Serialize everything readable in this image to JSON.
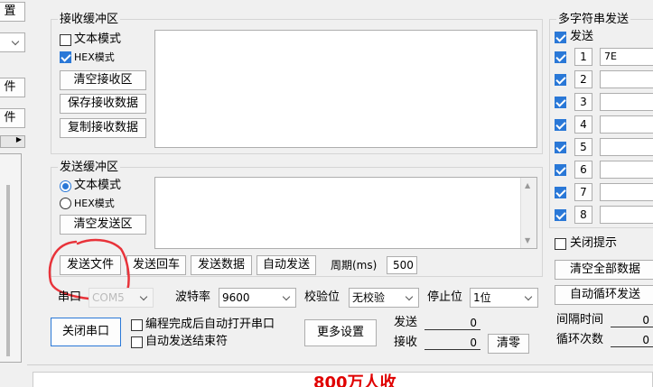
{
  "left_edge": {
    "top_label": "置",
    "item_a": "件",
    "item_b": "件"
  },
  "receive": {
    "title": "接收缓冲区",
    "text_mode": "文本模式",
    "hex_mode": "HEX模式",
    "clear_btn": "清空接收区",
    "save_btn": "保存接收数据",
    "copy_btn": "复制接收数据"
  },
  "send": {
    "title": "发送缓冲区",
    "text_mode": "文本模式",
    "hex_mode": "HEX模式",
    "clear_btn": "清空发送区"
  },
  "actions": {
    "send_file": "发送文件",
    "send_cr": "发送回车",
    "send_data": "发送数据",
    "auto_send": "自动发送",
    "period_label": "周期(ms)",
    "period_value": "500"
  },
  "port": {
    "port_label": "串口",
    "port_value": "COM5",
    "baud_label": "波特率",
    "baud_value": "9600",
    "parity_label": "校验位",
    "parity_value": "无校验",
    "stop_label": "停止位",
    "stop_value": "1位"
  },
  "bottom": {
    "close_port": "关闭串口",
    "auto_open": "编程完成后自动打开串口",
    "auto_end": "自动发送结束符",
    "more_settings": "更多设置",
    "send_label": "发送",
    "send_count": "0",
    "recv_label": "接收",
    "recv_count": "0",
    "clear_counts": "清零"
  },
  "multi": {
    "title": "多字符串发送",
    "send_label": "发送",
    "rows": [
      {
        "num": "1",
        "value": "7E"
      },
      {
        "num": "2",
        "value": ""
      },
      {
        "num": "3",
        "value": ""
      },
      {
        "num": "4",
        "value": ""
      },
      {
        "num": "5",
        "value": ""
      },
      {
        "num": "6",
        "value": ""
      },
      {
        "num": "7",
        "value": ""
      },
      {
        "num": "8",
        "value": ""
      }
    ],
    "close_tip": "关闭提示",
    "clear_all": "清空全部数据",
    "auto_loop": "自动循环发送",
    "interval_label": "间隔时间",
    "interval_value": "0",
    "loop_label": "循环次数",
    "loop_value": "0"
  },
  "footer_text": "800万人收",
  "colors": {
    "accent": "#2a78d7",
    "annotation": "#e8333a",
    "footer_text": "#e00000"
  }
}
